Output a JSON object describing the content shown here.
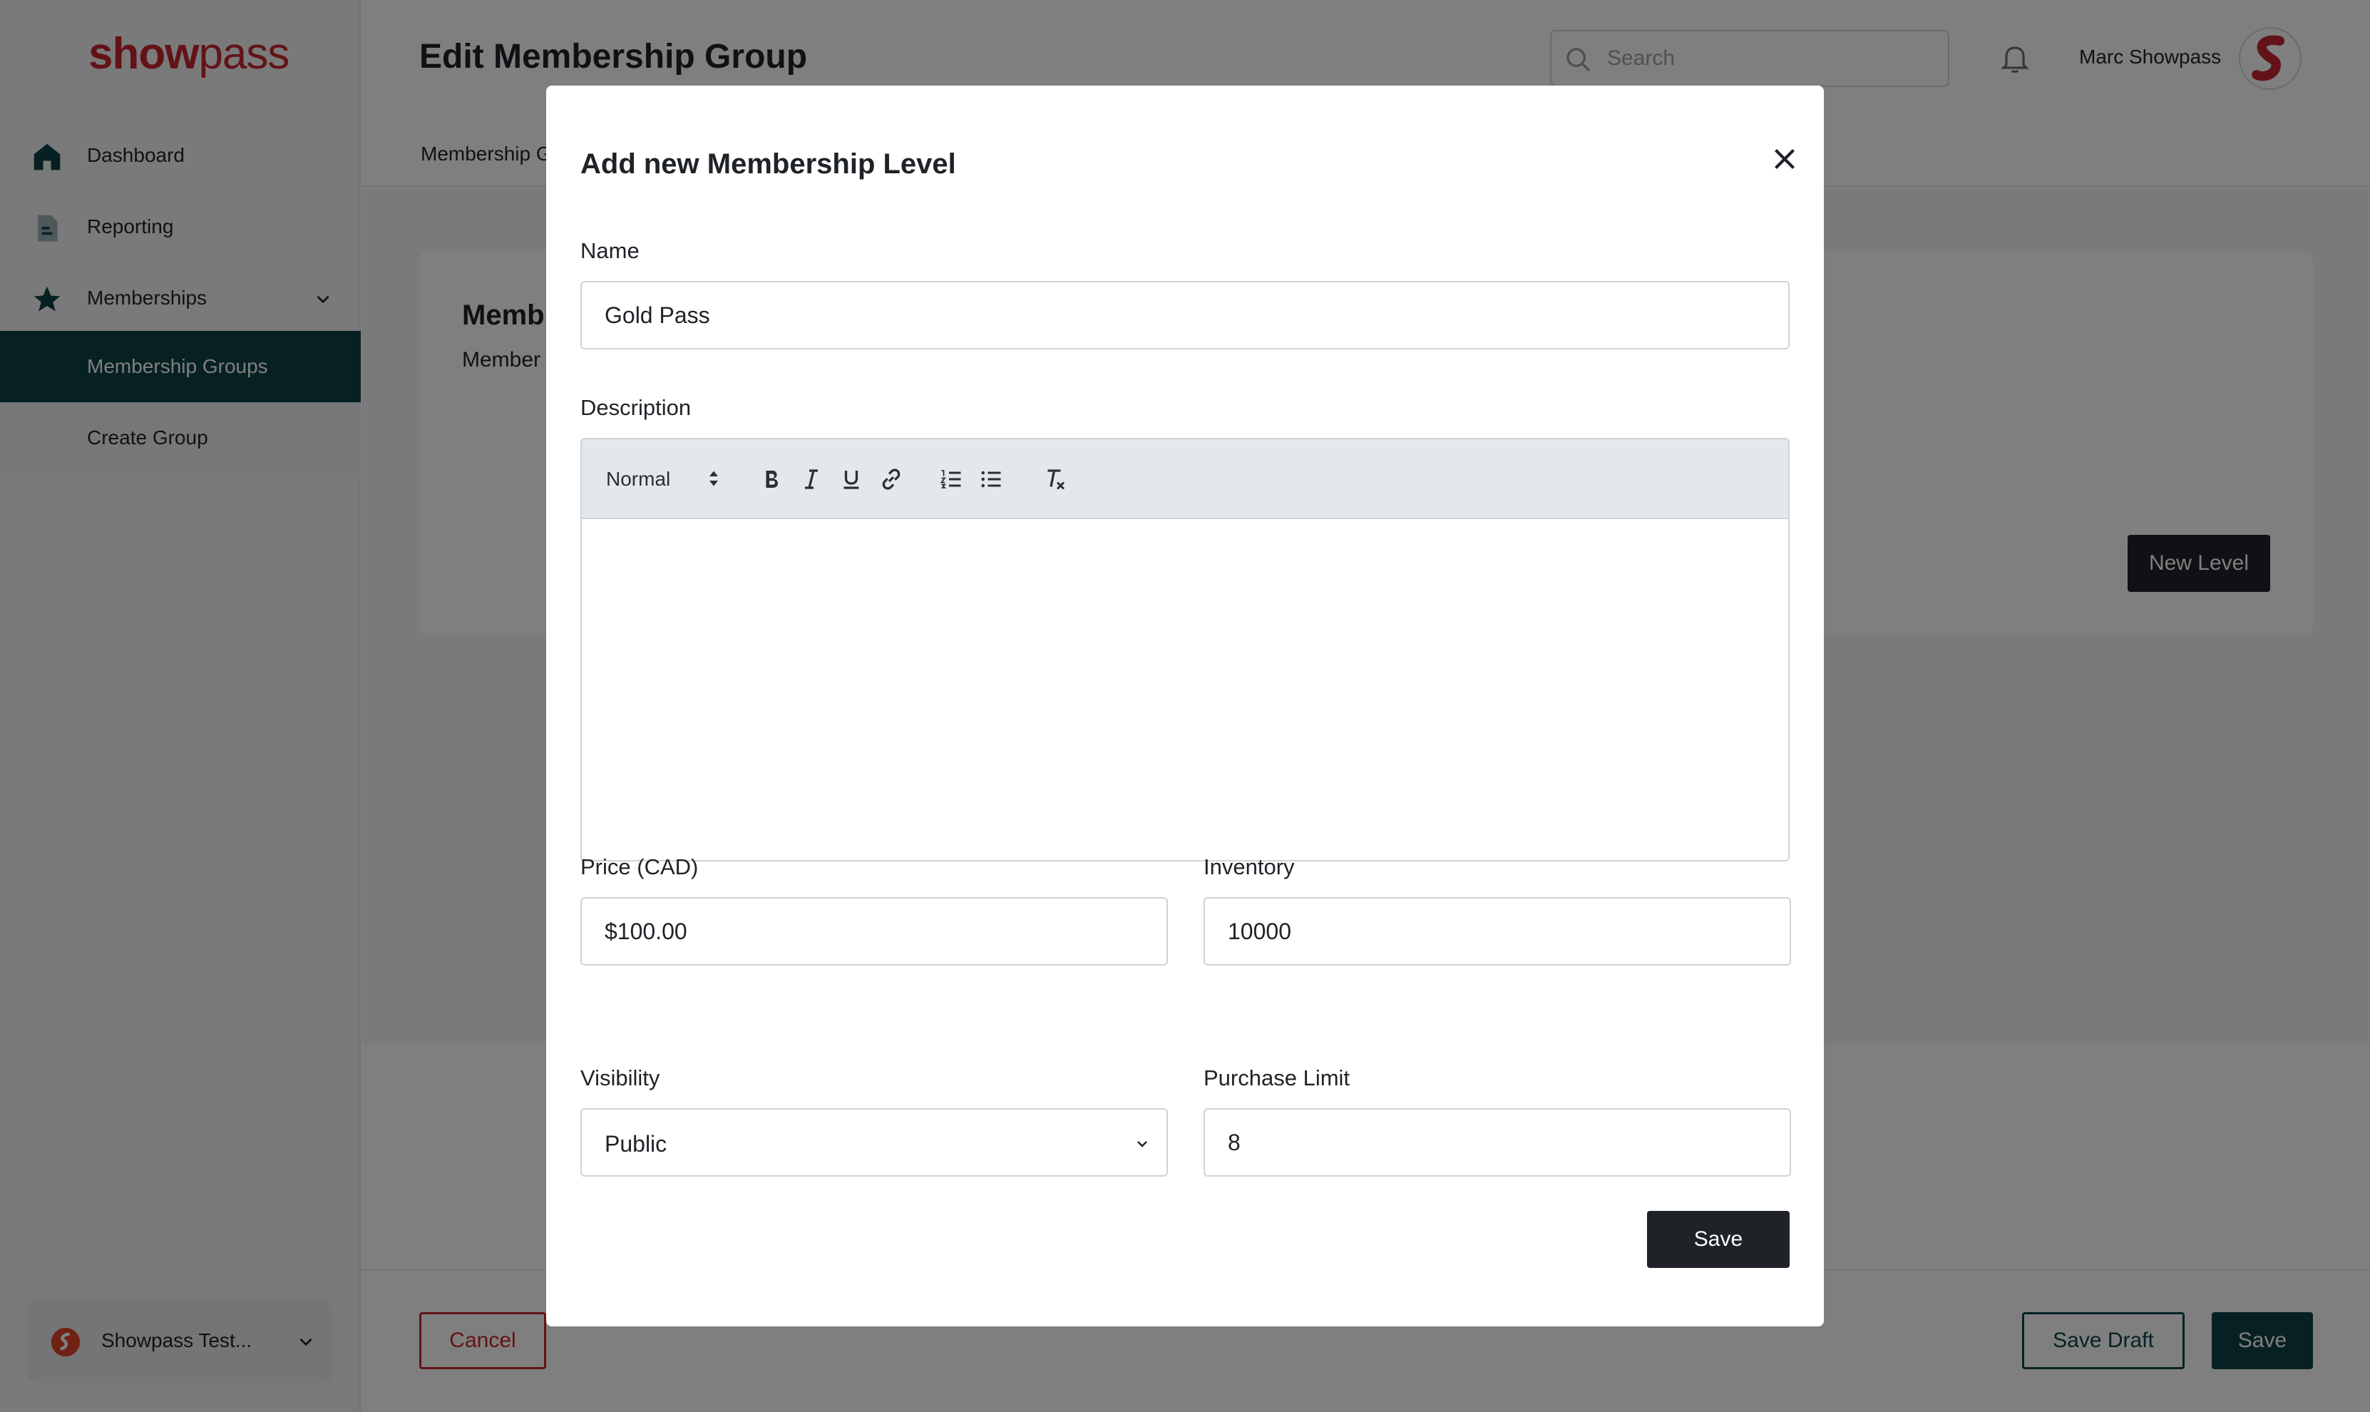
{
  "brand": {
    "logo_bold": "show",
    "logo_light": "pass"
  },
  "sidebar": {
    "items": [
      {
        "label": "Dashboard",
        "icon": "home-icon"
      },
      {
        "label": "Reporting",
        "icon": "report-icon"
      },
      {
        "label": "Memberships",
        "icon": "star-icon"
      },
      {
        "label": "Membership Groups"
      },
      {
        "label": "Create Group"
      }
    ],
    "org_switcher": {
      "label": "Showpass Test..."
    }
  },
  "header": {
    "title": "Edit Membership Group",
    "search_placeholder": "Search",
    "user_name": "Marc Showpass",
    "subtab": "Membership G"
  },
  "main": {
    "card_title": "Memb",
    "card_subtitle": "Member",
    "new_level_label": "New Level"
  },
  "footer": {
    "cancel_label": "Cancel",
    "save_draft_label": "Save Draft",
    "save_label": "Save"
  },
  "modal": {
    "title": "Add new Membership Level",
    "name_label": "Name",
    "name_value": "Gold Pass",
    "description_label": "Description",
    "description_format": "Normal",
    "price_label": "Price (CAD)",
    "price_value": "$100.00",
    "inventory_label": "Inventory",
    "inventory_value": "10000",
    "visibility_label": "Visibility",
    "visibility_value": "Public",
    "purchase_limit_label": "Purchase Limit",
    "purchase_limit_value": "8",
    "save_label": "Save"
  },
  "colors": {
    "brand_red": "#c7272f",
    "primary_teal": "#0e4247",
    "dark_button": "#1f2328"
  }
}
